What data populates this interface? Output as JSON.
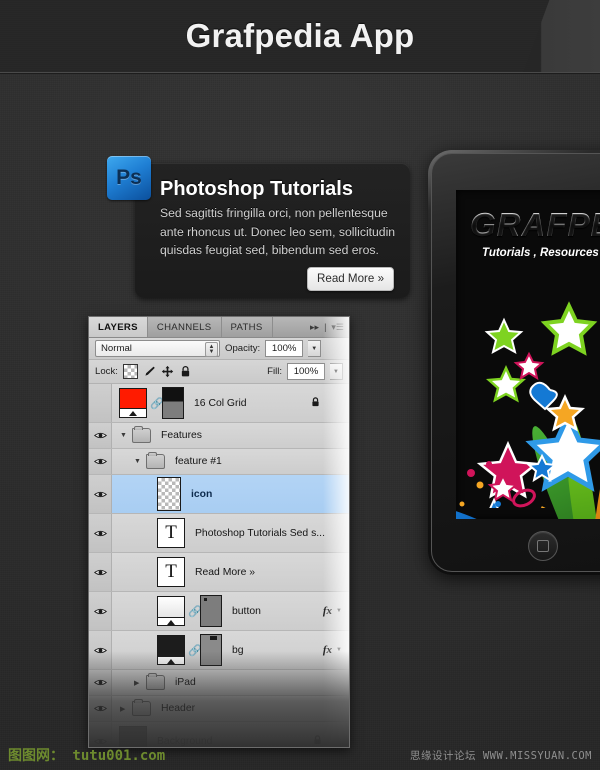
{
  "header": {
    "title": "Grafpedia App"
  },
  "feature_card": {
    "icon_label": "Ps",
    "title": "Photoshop Tutorials",
    "body": "Sed sagittis fringilla orci, non pellentesque ante rhoncus ut. Donec leo sem, sollicitudin quisdas feugiat sed, bibendum sed eros.",
    "read_more_label": "Read More »"
  },
  "ipad": {
    "logo": "GRAFPEDIA",
    "tagline": "Tutorials , Resources"
  },
  "layers_panel": {
    "tabs": [
      {
        "label": "LAYERS",
        "active": true
      },
      {
        "label": "CHANNELS",
        "active": false
      },
      {
        "label": "PATHS",
        "active": false
      }
    ],
    "collapse_icon": "▸▸",
    "menu_icon": "▾☰",
    "blend_mode": "Normal",
    "opacity_label": "Opacity:",
    "opacity_value": "100%",
    "lock_label": "Lock:",
    "lock_icons": [
      "transparency-lock-icon",
      "brush-lock-icon",
      "move-lock-icon",
      "all-lock-icon"
    ],
    "fill_label": "Fill:",
    "fill_value": "100%",
    "layers": [
      {
        "name": "16 Col Grid",
        "type": "adjustment",
        "visible": false,
        "selected": false,
        "locked": true,
        "fx": false,
        "thumb_color": "#ff1b00"
      },
      {
        "name": "Features",
        "type": "group",
        "visible": true,
        "selected": false,
        "expanded": true,
        "indent": 0
      },
      {
        "name": "feature #1",
        "type": "group",
        "visible": true,
        "selected": false,
        "expanded": true,
        "indent": 1
      },
      {
        "name": "icon",
        "type": "pixel",
        "visible": true,
        "selected": true,
        "fx": false
      },
      {
        "name": "Photoshop Tutorials Sed s...",
        "type": "text",
        "visible": true,
        "selected": false,
        "fx": false
      },
      {
        "name": "Read More »",
        "type": "text",
        "visible": true,
        "selected": false,
        "fx": false
      },
      {
        "name": "button",
        "type": "shape",
        "visible": true,
        "selected": false,
        "fx": true,
        "thumb_color": "#efefef"
      },
      {
        "name": "bg",
        "type": "shape",
        "visible": true,
        "selected": false,
        "fx": true,
        "thumb_color": "#1c1c1c"
      },
      {
        "name": "iPad",
        "type": "group",
        "visible": true,
        "selected": false,
        "expanded": false,
        "indent": 0
      },
      {
        "name": "Header",
        "type": "group",
        "visible": true,
        "selected": false,
        "expanded": false,
        "indent": 0
      },
      {
        "name": "Background",
        "type": "pixel",
        "visible": true,
        "selected": false,
        "faded": true
      }
    ]
  },
  "watermarks": {
    "left": "图图网： tutu001.com",
    "right": "思缘设计论坛 WWW.MISSYUAN.COM"
  },
  "colors": {
    "page_bg": "#2d2d2d",
    "header_bg": "#262626",
    "card_bg": "#1f1f1f",
    "ps_blue": "#1f7fd4",
    "selection_blue": "#a8cdf2",
    "panel_gray": "#d4d4d4",
    "watermark_green": "#6d8a2e"
  }
}
